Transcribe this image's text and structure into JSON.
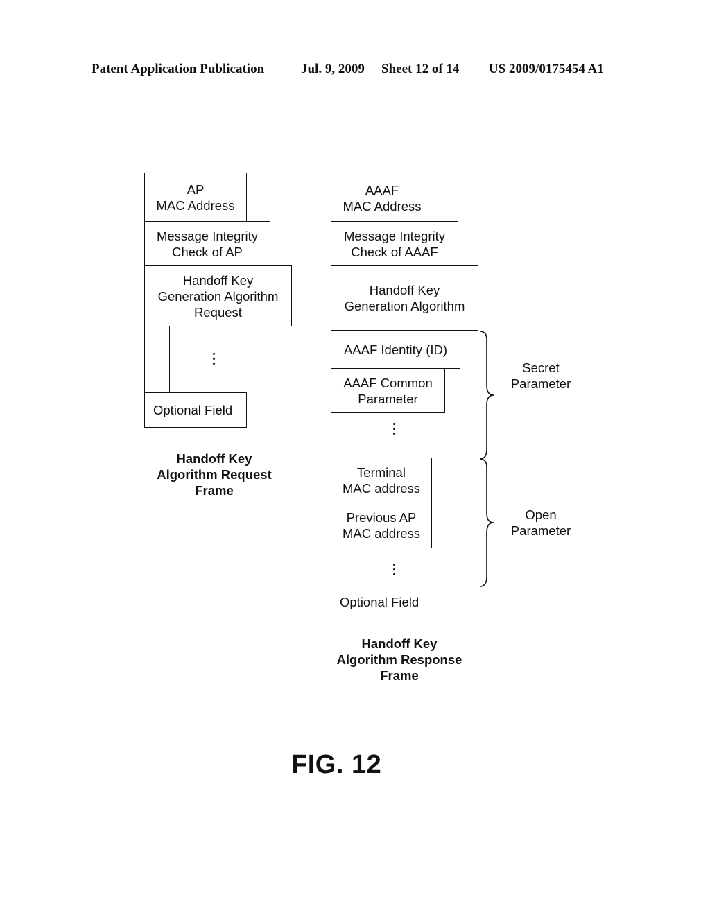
{
  "header": {
    "publication": "Patent Application Publication",
    "date": "Jul. 9, 2009",
    "sheet": "Sheet 12 of 14",
    "number": "US 2009/0175454 A1"
  },
  "request_frame": {
    "fields": [
      "AP\nMAC Address",
      "Message Integrity\nCheck of AP",
      "Handoff Key\nGeneration Algorithm\nRequest",
      "Optional Field"
    ],
    "caption": "Handoff Key\nAlgorithm Request\nFrame"
  },
  "response_frame": {
    "fields": [
      "AAAF\nMAC Address",
      "Message Integrity\nCheck of AAAF",
      "Handoff Key\nGeneration Algorithm",
      "AAAF Identity (ID)",
      "AAAF Common\nParameter",
      "Terminal\nMAC address",
      "Previous AP\nMAC address",
      "Optional Field"
    ],
    "caption": "Handoff Key\nAlgorithm Response\nFrame"
  },
  "braces": {
    "secret": "Secret\nParameter",
    "open": "Open\nParameter"
  },
  "figure_label": "FIG. 12"
}
